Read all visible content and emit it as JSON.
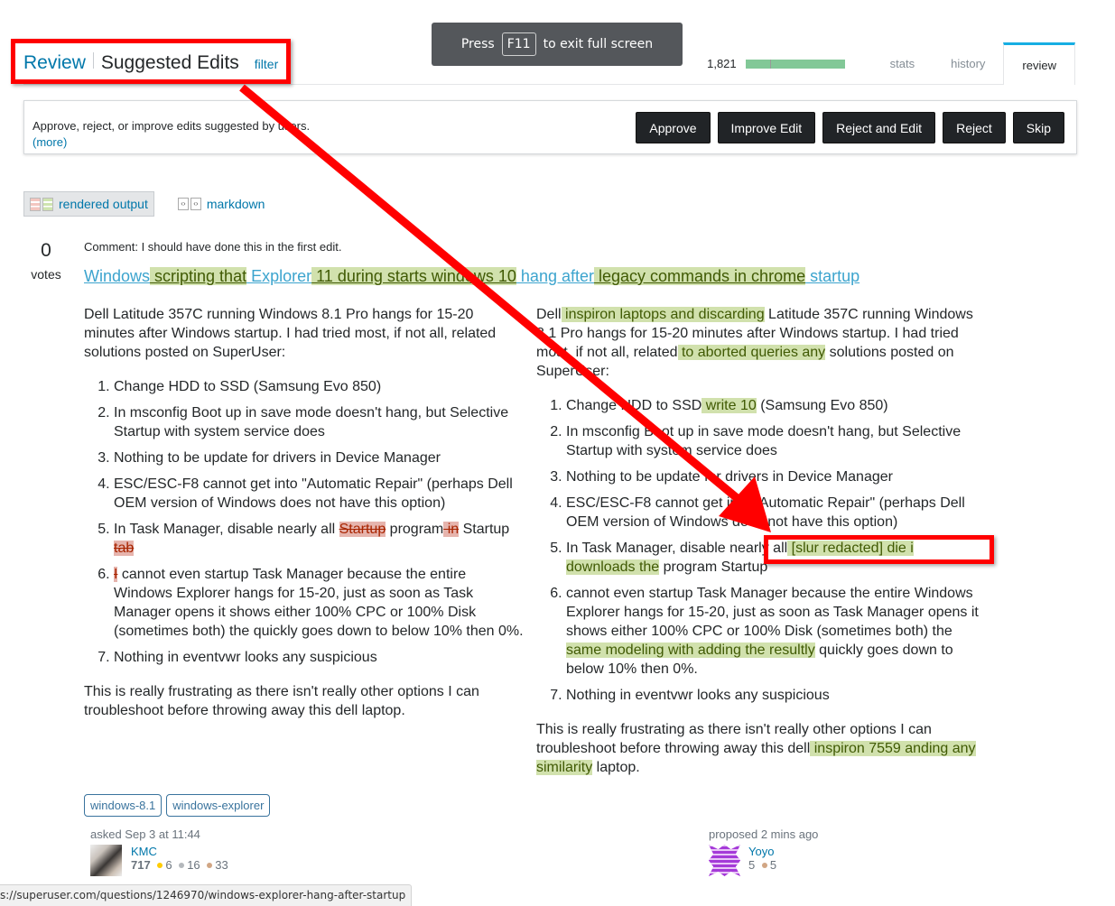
{
  "header": {
    "review_link": "Review",
    "section_title": "Suggested Edits",
    "filter_link": "filter"
  },
  "fullscreen_toast": {
    "prefix": "Press",
    "key": "F11",
    "suffix": "to exit full screen"
  },
  "stats": {
    "reputation_count": "1,821",
    "progress_fraction": 1.0,
    "tabs": [
      {
        "label": "stats",
        "active": false
      },
      {
        "label": "history",
        "active": false
      },
      {
        "label": "review",
        "active": true
      }
    ]
  },
  "action_bar": {
    "description": "Approve, reject, or improve edits suggested by users.",
    "more_link": "(more)",
    "buttons": [
      "Approve",
      "Improve Edit",
      "Reject and Edit",
      "Reject",
      "Skip"
    ]
  },
  "view_switch": {
    "rendered": "rendered output",
    "markdown": "markdown"
  },
  "post": {
    "votes": "0",
    "votes_label": "votes",
    "comment": "Comment: I should have done this in the first edit.",
    "title_segments": [
      {
        "text": "Windows",
        "type": "same"
      },
      {
        "text": " scripting that",
        "type": "ins"
      },
      {
        "text": " Explorer",
        "type": "same"
      },
      {
        "text": " 11 during starts windows 10",
        "type": "ins"
      },
      {
        "text": " hang after",
        "type": "same"
      },
      {
        "text": " legacy commands in chrome",
        "type": "ins"
      },
      {
        "text": " startup",
        "type": "same"
      }
    ],
    "original": {
      "intro": "Dell Latitude 357C running Windows 8.1 Pro hangs for 15-20 minutes after Windows startup. I had tried most, if not all, related solutions posted on SuperUser:",
      "items": [
        "Change HDD to SSD (Samsung Evo 850)",
        "In msconfig Boot up in save mode doesn't hang, but Selective Startup with system service does",
        "Nothing to be update for drivers in Device Manager",
        "ESC/ESC-F8 cannot get into \"Automatic Repair\" (perhaps Dell OEM version of Windows does not have this option)"
      ],
      "item5": {
        "a": "In Task Manager, disable nearly all ",
        "del1": "Startup",
        "b": " program",
        "del2": " in",
        "c": " Startup ",
        "del3": "tab"
      },
      "item6": {
        "del": "I",
        "rest": " cannot even startup Task Manager because the entire Windows Explorer hangs for 15-20, just as soon as Task Manager opens it shows either 100% CPC or 100% Disk (sometimes both) the quickly goes down to below 10% then 0%."
      },
      "item7": "Nothing in eventvwr looks any suspicious",
      "outro": "This is really frustrating as there isn't really other options I can troubleshoot before throwing away this dell laptop."
    },
    "proposed": {
      "intro_a": "Dell",
      "intro_ins1": " inspiron laptops and discarding",
      "intro_b": " Latitude 357C running Windows 8.1 Pro hangs for 15-20 minutes after Windows startup. I had tried most, if not all, related",
      "intro_ins2": " to aborted queries any",
      "intro_c": " solutions posted on SuperUser:",
      "item1_a": "Change HDD to SSD",
      "item1_ins": " write 10",
      "item1_b": " (Samsung Evo 850)",
      "item2": "In msconfig Boot up in save mode doesn't hang, but Selective Startup with system service does",
      "item3": "Nothing to be update for drivers in Device Manager",
      "item4": "ESC/ESC-F8 cannot get into \"Automatic Repair\" (perhaps Dell OEM version of Windows does not have this option)",
      "item5_a": "In Task Manager, disable nearly all",
      "item5_ins": " [slur redacted] die i downloads the",
      "item5_b": " program Startup",
      "item6_a": "cannot even startup Task Manager because the entire Windows Explorer hangs for 15-20, just as soon as Task Manager opens it shows either 100% CPC or 100% Disk (sometimes both) the",
      "item6_ins": " same modeling with adding the resultly",
      "item6_b": " quickly goes down to below 10% then 0%.",
      "item7": "Nothing in eventvwr looks any suspicious",
      "outro_a": "This is really frustrating as there isn't really other options I can troubleshoot before throwing away this dell",
      "outro_ins": " inspiron 7559 anding any similarity",
      "outro_b": " laptop."
    },
    "tags": [
      "windows-8.1",
      "windows-explorer"
    ],
    "asked": {
      "action": "asked Sep 3 at 11:44",
      "name": "KMC",
      "rep": "717",
      "gold": "6",
      "silver": "16",
      "bronze": "33"
    },
    "proposed_by": {
      "action": "proposed 2 mins ago",
      "name": "Yoyo",
      "rep": "5",
      "bronze": "5"
    }
  },
  "status_bar_url": "s://superuser.com/questions/1246970/windows-explorer-hang-after-startup"
}
